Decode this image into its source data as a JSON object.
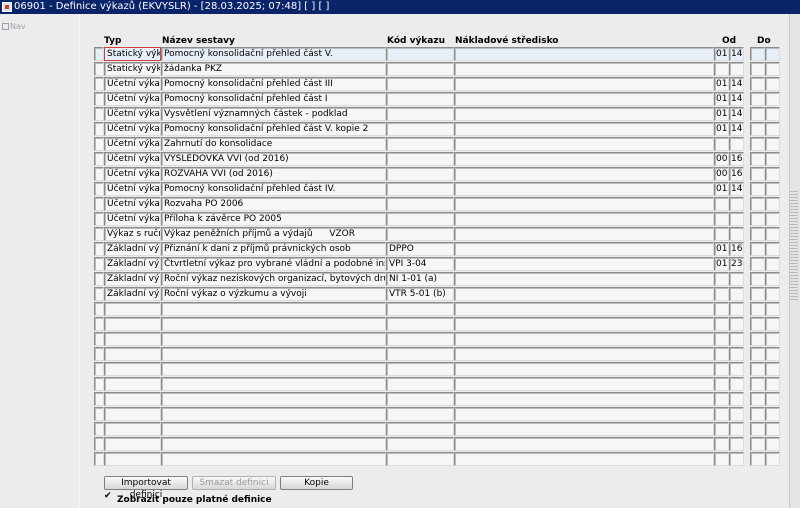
{
  "window": {
    "title": "06901 - Definice výkazů (EKVYSLR) - [28.03.2025; 07:48]  [ ]  [ ]"
  },
  "nav": {
    "label": "Nav"
  },
  "columns": {
    "typ": "Typ",
    "nazev": "Název sestavy",
    "kod": "Kód výkazu",
    "nakladove": "Nákladové středisko",
    "od": "Od",
    "do": "Do"
  },
  "rows": [
    {
      "typ": "Statický výkaz",
      "nazev": "Pomocný konsolidační přehled část V.",
      "nazev_extra": "",
      "kod": "",
      "od1": "01",
      "od2": "14"
    },
    {
      "typ": "Statický výkaz",
      "nazev": "žádanka PKZ",
      "nazev_extra": "",
      "kod": "",
      "od1": "",
      "od2": ""
    },
    {
      "typ": "Účetní výkaz",
      "nazev": "Pomocný konsolidační přehled část III",
      "nazev_extra": "",
      "kod": "",
      "od1": "01",
      "od2": "14"
    },
    {
      "typ": "Účetní výkaz",
      "nazev": "Pomocný konsolidační přehled část I",
      "nazev_extra": "",
      "kod": "",
      "od1": "01",
      "od2": "14"
    },
    {
      "typ": "Účetní výkaz",
      "nazev": "Vysvětlení významných částek - podklad",
      "nazev_extra": "",
      "kod": "",
      "od1": "01",
      "od2": "14"
    },
    {
      "typ": "Účetní výkaz",
      "nazev": "Pomocný konsolidační přehled část V. kopie 2",
      "nazev_extra": "",
      "kod": "",
      "od1": "01",
      "od2": "14"
    },
    {
      "typ": "Účetní výkaz",
      "nazev": "Zahrnutí do konsolidace",
      "nazev_extra": "",
      "kod": "",
      "od1": "",
      "od2": ""
    },
    {
      "typ": "Účetní výkaz",
      "nazev": "VÝSLEDOVKA VVI (od 2016)",
      "nazev_extra": "",
      "kod": "",
      "od1": "00",
      "od2": "16"
    },
    {
      "typ": "Účetní výkaz",
      "nazev": "ROZVAHA VVI (od 2016)",
      "nazev_extra": "",
      "kod": "",
      "od1": "00",
      "od2": "16"
    },
    {
      "typ": "Účetní výkaz",
      "nazev": "Pomocný konsolidační přehled část IV.",
      "nazev_extra": "",
      "kod": "",
      "od1": "01",
      "od2": "14"
    },
    {
      "typ": "Účetní výkaz",
      "nazev": "Rozvaha PO 2006",
      "nazev_extra": "",
      "kod": "",
      "od1": "",
      "od2": ""
    },
    {
      "typ": "Účetní výkaz",
      "nazev": "Příloha k závěrce PO 2005",
      "nazev_extra": "",
      "kod": "",
      "od1": "",
      "od2": ""
    },
    {
      "typ": "Výkaz s ruční",
      "nazev": "Výkaz peněžních příjmů a výdajů",
      "nazev_extra": "VZOR",
      "kod": "",
      "od1": "",
      "od2": ""
    },
    {
      "typ": "Základní výkaz",
      "nazev": "Přiznání k dani z příjmů právnických osob",
      "nazev_extra": "",
      "kod": "DPPO",
      "od1": "01",
      "od2": "16"
    },
    {
      "typ": "Základní výkaz",
      "nazev": "Čtvrtletní výkaz pro vybrané vládní a podobné instituce",
      "nazev_extra": "",
      "kod": "VPI 3-04",
      "od1": "01",
      "od2": "23"
    },
    {
      "typ": "Základní výkaz",
      "nazev": "Roční výkaz neziskových organizací, bytových družstev...",
      "nazev_extra": "",
      "kod": "NI 1-01 (a)",
      "od1": "",
      "od2": ""
    },
    {
      "typ": "Základní výkaz",
      "nazev": "Roční výkaz o výzkumu a vývoji",
      "nazev_extra": "",
      "kod": "VTR 5-01 (b)",
      "od1": "",
      "od2": ""
    }
  ],
  "buttons": {
    "import": "Importovat definici",
    "delete": "Smazat definici",
    "copy": "Kopie"
  },
  "filter": {
    "label": "Zobrazit pouze platné definice",
    "checked": true
  }
}
